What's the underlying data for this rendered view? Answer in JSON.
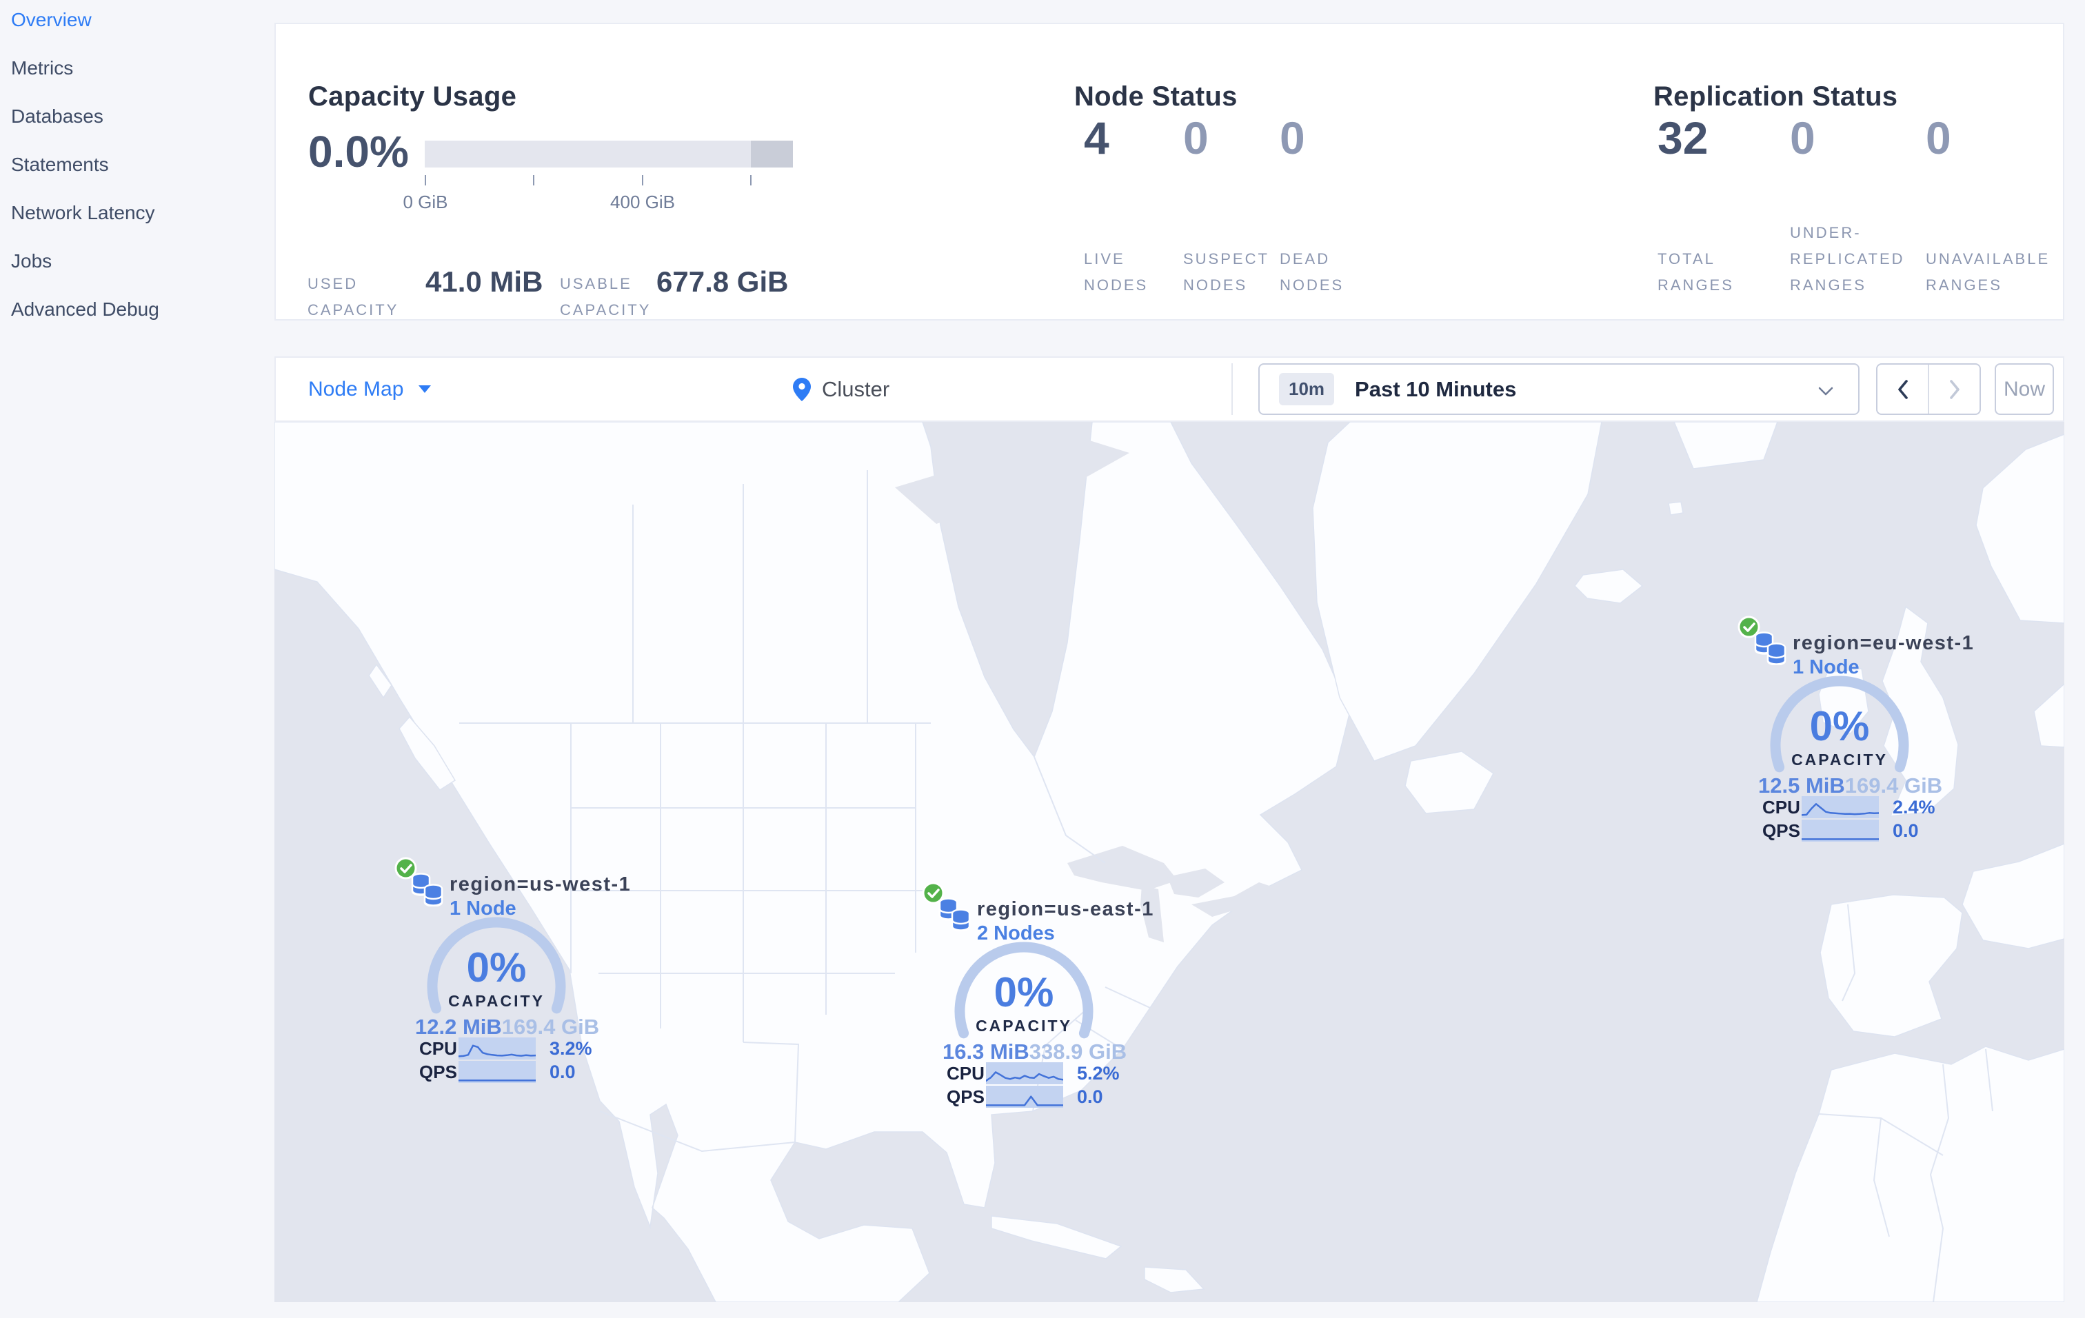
{
  "colors": {
    "accent_blue": "#2e7cf5",
    "link_blue": "#4a80e2",
    "ocean": "#e2e5ee",
    "land": "#fcfdff",
    "ring": "#b9cbec",
    "spark_band": "#c3d3f1",
    "spark_line": "#4272d9",
    "green_ok": "#53b24a"
  },
  "sidebar": {
    "items": [
      {
        "label": "Overview"
      },
      {
        "label": "Metrics"
      },
      {
        "label": "Databases"
      },
      {
        "label": "Statements"
      },
      {
        "label": "Network Latency"
      },
      {
        "label": "Jobs"
      },
      {
        "label": "Advanced Debug"
      }
    ]
  },
  "summary": {
    "capacity": {
      "title": "Capacity Usage",
      "percent": "0.0%",
      "tick_labels": [
        "0 GiB",
        "400 GiB"
      ],
      "used_label_lines": [
        "USED",
        "CAPACITY"
      ],
      "used_value": "41.0 MiB",
      "usable_label_lines": [
        "USABLE",
        "CAPACITY"
      ],
      "usable_value": "677.8 GiB"
    },
    "node_status": {
      "title": "Node Status",
      "stats": [
        {
          "value": "4",
          "lines": [
            "LIVE",
            "NODES"
          ]
        },
        {
          "value": "0",
          "lines": [
            "SUSPECT",
            "NODES"
          ]
        },
        {
          "value": "0",
          "lines": [
            "DEAD",
            "NODES"
          ]
        }
      ]
    },
    "replication": {
      "title": "Replication Status",
      "stats": [
        {
          "value": "32",
          "lines": [
            "TOTAL",
            "RANGES"
          ]
        },
        {
          "value": "0",
          "lines": [
            "UNDER-",
            "REPLICATED",
            "RANGES"
          ]
        },
        {
          "value": "0",
          "lines": [
            "UNAVAILABLE",
            "RANGES"
          ]
        }
      ]
    }
  },
  "toolbar": {
    "view_label": "Node Map",
    "breadcrumb": "Cluster",
    "time_badge": "10m",
    "time_label": "Past 10 Minutes",
    "now_label": "Now"
  },
  "map": {
    "regions": [
      {
        "label": "region=eu-west-1",
        "nodes": "1 Node",
        "percent": "0%",
        "capacity_label": "CAPACITY",
        "used": "12.5 MiB",
        "usable": "169.4 GiB",
        "cpu_label": "CPU",
        "cpu_value": "2.4%",
        "qps_label": "QPS",
        "qps_value": "0.0",
        "cpu_spark": [
          0.1,
          0.12,
          0.45,
          0.72,
          0.5,
          0.28,
          0.22,
          0.2,
          0.18,
          0.16,
          0.17,
          0.15,
          0.16,
          0.18,
          0.22,
          0.2,
          0.21
        ],
        "qps_spark": [
          0.06,
          0.06,
          0.06,
          0.06,
          0.06,
          0.06,
          0.06,
          0.06,
          0.06,
          0.06,
          0.06,
          0.06,
          0.06
        ]
      },
      {
        "label": "region=us-west-1",
        "nodes": "1 Node",
        "percent": "0%",
        "capacity_label": "CAPACITY",
        "used": "12.2 MiB",
        "usable": "169.4 GiB",
        "cpu_label": "CPU",
        "cpu_value": "3.2%",
        "qps_label": "QPS",
        "qps_value": "0.0",
        "cpu_spark": [
          0.1,
          0.12,
          0.18,
          0.7,
          0.62,
          0.3,
          0.22,
          0.18,
          0.15,
          0.14,
          0.16,
          0.2,
          0.15,
          0.13,
          0.16,
          0.14,
          0.15
        ],
        "qps_spark": [
          0.06,
          0.06,
          0.06,
          0.06,
          0.06,
          0.06,
          0.06,
          0.06,
          0.06,
          0.06,
          0.06,
          0.06,
          0.06
        ]
      },
      {
        "label": "region=us-east-1",
        "nodes": "2 Nodes",
        "percent": "0%",
        "capacity_label": "CAPACITY",
        "used": "16.3 MiB",
        "usable": "338.9 GiB",
        "cpu_label": "CPU",
        "cpu_value": "5.2%",
        "qps_label": "QPS",
        "qps_value": "0.0",
        "cpu_spark": [
          0.12,
          0.3,
          0.6,
          0.45,
          0.28,
          0.22,
          0.3,
          0.25,
          0.4,
          0.3,
          0.28,
          0.5,
          0.38,
          0.28,
          0.35,
          0.22,
          0.18
        ],
        "qps_spark": [
          0.06,
          0.06,
          0.06,
          0.06,
          0.06,
          0.06,
          0.06,
          0.55,
          0.06,
          0.06,
          0.06,
          0.06,
          0.06
        ]
      }
    ]
  }
}
